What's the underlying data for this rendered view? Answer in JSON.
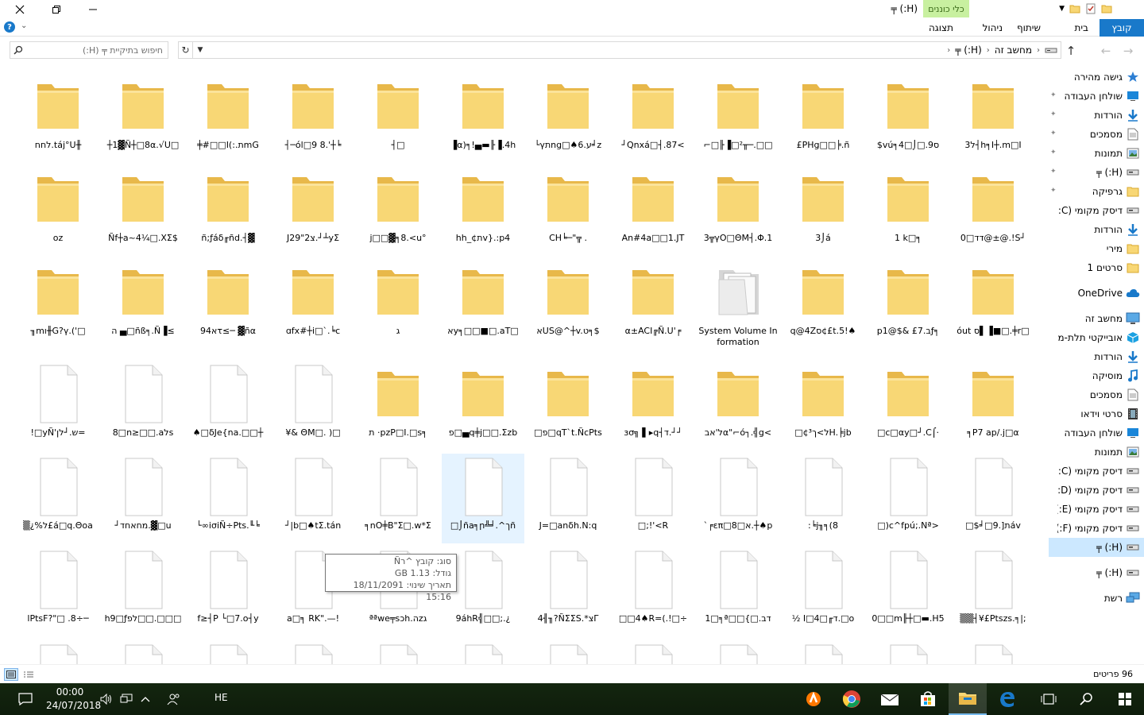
{
  "window": {
    "title": "(H:) ╤",
    "context_tab": "כלי כוננים",
    "context_subtab": "ניהול",
    "tabs": [
      "קובץ",
      "בית",
      "שיתוף",
      "תצוגה"
    ]
  },
  "address": {
    "breadcrumbs": [
      "מחשב זה",
      "(H:) ╤"
    ],
    "search_placeholder": "חיפוש בתיקיית ╤ (H:)"
  },
  "items": [
    {
      "label": "לחח.táj°U╫",
      "type": "folder"
    },
    {
      "label": "┼1▓Ñ┼□8α.√U□",
      "type": "folder"
    },
    {
      "label": "╪#□□I(:.תmG",
      "type": "folder"
    },
    {
      "label": "┤─ól□9 8.'┼╘",
      "type": "folder"
    },
    {
      "label": "┤□",
      "type": "folder"
    },
    {
      "label": "▐α)╕!▄▬╟▐.4h",
      "type": "folder"
    },
    {
      "label": "└γתng□♠6.ע╛z",
      "type": "folder"
    },
    {
      "label": "┘Qnxá□┤.87<",
      "type": "folder"
    },
    {
      "label": "⌐□╟▐□²╥─.□□",
      "type": "folder"
    },
    {
      "label": "£PHg□□╞.ñ",
      "type": "folder"
    },
    {
      "label": "$vú╕4□⌡□.9ס",
      "type": "folder"
    },
    {
      "label": "3ל┤h╕I┼.m□I",
      "type": "folder"
    },
    {
      "label": "oz",
      "type": "folder"
    },
    {
      "label": "Ñf┼a~4¼□.XΣ$",
      "type": "folder"
    },
    {
      "label": "ñ;ƒáδ╓ñd.┤▓",
      "type": "folder"
    },
    {
      "label": "J29\"2צ.┘┴yΣ",
      "type": "folder"
    },
    {
      "label": "j□□▓╕8.<u°",
      "type": "folder"
    },
    {
      "label": "hh_¢תv}.:p4",
      "type": "folder"
    },
    {
      "label": "CH╘─\"╦ .",
      "type": "folder"
    },
    {
      "label": "An#4a□□1.JT",
      "type": "folder"
    },
    {
      "label": "3╦γO□ΘM┤.Φ.1",
      "type": "folder"
    },
    {
      "label": "3⌡á",
      "type": "folder"
    },
    {
      "label": "1 k□╕",
      "type": "folder"
    },
    {
      "label": "0□דד@±@.!S┘",
      "type": "folder"
    },
    {
      "label": "╖mı╫G?γ.('□",
      "type": "folder"
    },
    {
      "label": "ה ▄□ñß╕.Ñ▐≤",
      "type": "folder"
    },
    {
      "label": "א94τ≤─ ▓ñα",
      "type": "folder"
    },
    {
      "label": "ɑfx#┼i□`.╘c",
      "type": "folder"
    },
    {
      "label": "ג",
      "type": "folder"
    },
    {
      "label": "אy╕□□■□.aT□",
      "type": "folder"
    },
    {
      "label": "אUS@^┼v.ט╕$",
      "type": "folder"
    },
    {
      "label": "α±ACI╔Ñ.U'╒",
      "type": "folder"
    },
    {
      "label": "System Volume Information",
      "type": "sysfolder"
    },
    {
      "label": "q@4Zס¢£t.5!♠",
      "type": "folder"
    },
    {
      "label": "p1@$& £7.בƒ╕",
      "type": "folder"
    },
    {
      "label": "óut ס▌▐■□.╪r□",
      "type": "folder"
    },
    {
      "label": "!□yÑ'ש.┘לן=",
      "type": "file"
    },
    {
      "label": "8□n≥□□.aלs",
      "type": "file"
    },
    {
      "label": "♠□δJe{na.□□┼",
      "type": "file"
    },
    {
      "label": "¥& ΘM□. )□",
      "type": "file"
    },
    {
      "label": "ת ·pzP□I.□s╕",
      "type": "folder"
    },
    {
      "label": "פ□▄q╪j□□.Σzb",
      "type": "folder"
    },
    {
      "label": "□פ□qT`t.ÑcPts",
      "type": "folder"
    },
    {
      "label": "ɜσ╗ ▌▸q┤ד.┘┘",
      "type": "folder"
    },
    {
      "label": "ל'אבα\"⌐ó┐.╣g<",
      "type": "folder"
    },
    {
      "label": "□ל>ך¢³H.╞jb",
      "type": "folder"
    },
    {
      "label": "□c□αy□┘.C⌠·",
      "type": "folder"
    },
    {
      "label": "╕P7 ap/.j□α",
      "type": "folder"
    },
    {
      "label": "▒¿%ל£á□q.Θoa",
      "type": "file"
    },
    {
      "label": "┘מחאחד.▓□u",
      "type": "file"
    },
    {
      "label": "└∞iσiÑ÷Pts.╙╘",
      "type": "file"
    },
    {
      "label": "┘|b□♠tΣ.tán",
      "type": "file"
    },
    {
      "label": "╕nO╪B\"Σ□.w*Σ",
      "type": "file"
    },
    {
      "label": "□⌡ñа╕ր╩╛.^ךñ",
      "type": "file"
    },
    {
      "label": "J=□anδh.N:q",
      "type": "file"
    },
    {
      "label": "□;!'<R",
      "type": "file"
    },
    {
      "label": "`╒επ□א□8.┼♠p",
      "type": "file"
    },
    {
      "label": ":╘j╖╕(8",
      "type": "file"
    },
    {
      "label": "□)c^fpú;.Nª>",
      "type": "file"
    },
    {
      "label": "□$╛□ת[.9áv",
      "type": "file"
    },
    {
      "label": "lPtsF?\"□ .8÷─",
      "type": "file"
    },
    {
      "label": "h9□ƒלפ□□.□□□",
      "type": "file"
    },
    {
      "label": "f≥┤P └□7.o┤y",
      "type": "file"
    },
    {
      "label": "a□╕ RK\".—!",
      "type": "file"
    },
    {
      "label": "ªªwe╤sɔh.הzג",
      "type": "file"
    },
    {
      "label": "9áhR╣□□;.¿",
      "type": "file"
    },
    {
      "label": "4╢╖?ÑΣΣS.*צΓ",
      "type": "file"
    },
    {
      "label": "□□4♠R=(.!□÷",
      "type": "file"
    },
    {
      "label": "1□╕ª□□{□.דב",
      "type": "file"
    },
    {
      "label": "½ I□4□╓ד.□o",
      "type": "file"
    },
    {
      "label": "0□□m╟┼□▬.H5",
      "type": "file"
    },
    {
      "label": "▒▒┤¥£Ptszs.╕|;",
      "type": "file"
    }
  ],
  "selected_index": 53,
  "tooltip": {
    "type": "סוג: קובץ ^רÑ",
    "size": "גודל: 1.13 GB",
    "modified": "תאריך שינוי: 18/11/2091 15:16"
  },
  "nav": [
    {
      "label": "גישה מהירה",
      "icon": "star-icon",
      "pin": false
    },
    {
      "label": "שולחן העבודה",
      "icon": "desktop-icon",
      "pin": true
    },
    {
      "label": "הורדות",
      "icon": "download-icon",
      "pin": true
    },
    {
      "label": "מסמכים",
      "icon": "document-icon",
      "pin": true
    },
    {
      "label": "תמונות",
      "icon": "pictures-icon",
      "pin": true
    },
    {
      "label": "(H:) ╤",
      "icon": "drive-icon",
      "pin": true
    },
    {
      "label": "גרפיקה",
      "icon": "folder-icon",
      "pin": true
    },
    {
      "label": "דיסק מקומי (C:)",
      "icon": "drive-icon",
      "pin": false
    },
    {
      "label": "הורדות",
      "icon": "download-icon",
      "pin": false
    },
    {
      "label": "מירי",
      "icon": "folder-icon",
      "pin": false
    },
    {
      "label": "סרטים 1",
      "icon": "folder-icon",
      "pin": false
    },
    {
      "label": "OneDrive",
      "icon": "cloud-icon",
      "pin": false
    },
    {
      "label": "מחשב זה",
      "icon": "computer-icon",
      "pin": false
    },
    {
      "label": "אובייקטי תלת-ממד",
      "icon": "cube-icon",
      "pin": false
    },
    {
      "label": "הורדות",
      "icon": "download-icon",
      "pin": false
    },
    {
      "label": "מוסיקה",
      "icon": "music-icon",
      "pin": false
    },
    {
      "label": "מסמכים",
      "icon": "document-icon",
      "pin": false
    },
    {
      "label": "סרטי וידאו",
      "icon": "video-icon",
      "pin": false
    },
    {
      "label": "שולחן העבודה",
      "icon": "desktop-icon",
      "pin": false
    },
    {
      "label": "תמונות",
      "icon": "pictures-icon",
      "pin": false
    },
    {
      "label": "דיסק מקומי (C:)",
      "icon": "drive-icon",
      "pin": false
    },
    {
      "label": "דיסק מקומי (D:)",
      "icon": "drive-icon",
      "pin": false
    },
    {
      "label": "דיסק מקומי (E:)",
      "icon": "drive-icon",
      "pin": false
    },
    {
      "label": "דיסק מקומי (F:)",
      "icon": "drive-icon",
      "pin": false
    },
    {
      "label": "(H:) ╤",
      "icon": "drive-icon",
      "pin": false,
      "selected": true
    },
    {
      "label": "(H:) ╤",
      "icon": "drive-icon",
      "pin": false
    },
    {
      "label": "רשת",
      "icon": "network-icon",
      "pin": false
    }
  ],
  "status": {
    "count": "96 פריטים"
  },
  "taskbar": {
    "time": "00:00",
    "date": "24/07/2018",
    "lang": "HE"
  },
  "colors": {
    "accent": "#1979ca",
    "selection": "#cce8ff",
    "folder": "#f8d775",
    "context_tab": "#c8f0a0"
  }
}
